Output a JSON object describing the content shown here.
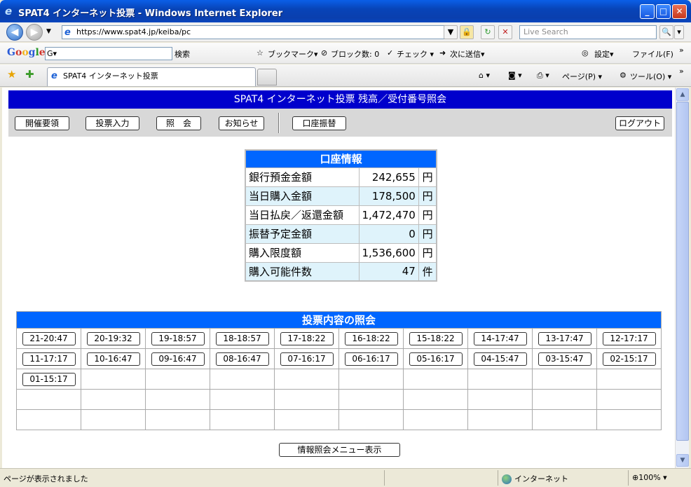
{
  "window": {
    "title": "SPAT4 インターネット投票 - Windows Internet Explorer",
    "minimize": "_",
    "maximize": "□",
    "close": "✕"
  },
  "address_bar": {
    "url": "https://www.spat4.jp/keiba/pc",
    "search_placeholder": "Live Search"
  },
  "google_toolbar": {
    "logo": "Google",
    "search_value": "G▾",
    "search_label": "検索",
    "bookmark": "ブックマーク▾",
    "blocked": "ブロック数: 0",
    "check": "チェック ▾",
    "send": "次に送信▾",
    "settings": "設定▾",
    "file_menu": "ファイル(F)"
  },
  "tab_bar": {
    "tab_title": "SPAT4 インターネット投票",
    "page_menu": "ページ(P) ▾",
    "tools_menu": "ツール(O) ▾"
  },
  "page": {
    "header": "SPAT4 インターネット投票 残高／受付番号照会",
    "menu": {
      "guide": "開催要領",
      "vote_input": "投票入力",
      "inquiry": "照　会",
      "news": "お知らせ",
      "transfer": "口座振替",
      "logout": "ログアウト"
    },
    "account": {
      "caption": "口座情報",
      "rows": [
        {
          "label": "銀行預金金額",
          "value": "242,655",
          "unit": "円"
        },
        {
          "label": "当日購入金額",
          "value": "178,500",
          "unit": "円"
        },
        {
          "label": "当日払戻／返還金額",
          "value": "1,472,470",
          "unit": "円"
        },
        {
          "label": "振替予定金額",
          "value": "0",
          "unit": "円"
        },
        {
          "label": "購入限度額",
          "value": "1,536,600",
          "unit": "円"
        },
        {
          "label": "購入可能件数",
          "value": "47",
          "unit": "件"
        }
      ]
    },
    "inquiry": {
      "caption": "投票内容の照会",
      "buttons": [
        "21-20:47",
        "20-19:32",
        "19-18:57",
        "18-18:57",
        "17-18:22",
        "16-18:22",
        "15-18:22",
        "14-17:47",
        "13-17:47",
        "12-17:17",
        "11-17:17",
        "10-16:47",
        "09-16:47",
        "08-16:47",
        "07-16:17",
        "06-16:17",
        "05-16:17",
        "04-15:47",
        "03-15:47",
        "02-15:17",
        "01-15:17"
      ]
    },
    "info_button": "情報照会メニュー表示"
  },
  "status_bar": {
    "message": "ページが表示されました",
    "zone": "インターネット",
    "zoom": "100%"
  }
}
